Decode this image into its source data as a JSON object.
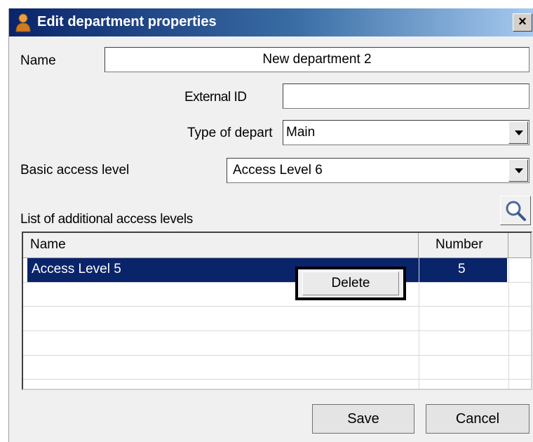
{
  "window": {
    "title": "Edit department properties",
    "close_symbol": "×",
    "icon": "person-icon"
  },
  "form": {
    "name_label": "Name",
    "name_value": "New department 2",
    "external_id_label": "External ID",
    "external_id_value": "",
    "type_label": "Type of depart",
    "type_value": "Main",
    "basic_access_label": "Basic access level",
    "basic_access_value": "Access Level 6"
  },
  "additional": {
    "list_label": "List of additional access levels",
    "search_icon": "magnifier-icon",
    "columns": [
      "Name",
      "Number"
    ],
    "rows": [
      {
        "name": "Access Level 5",
        "number": "5",
        "selected": true
      }
    ]
  },
  "context_menu": {
    "items": [
      "Delete"
    ]
  },
  "buttons": {
    "save": "Save",
    "cancel": "Cancel"
  },
  "colors": {
    "selection": "#0a246a",
    "title_bar_start": "#0a246a",
    "title_bar_end": "#a6caf0"
  }
}
